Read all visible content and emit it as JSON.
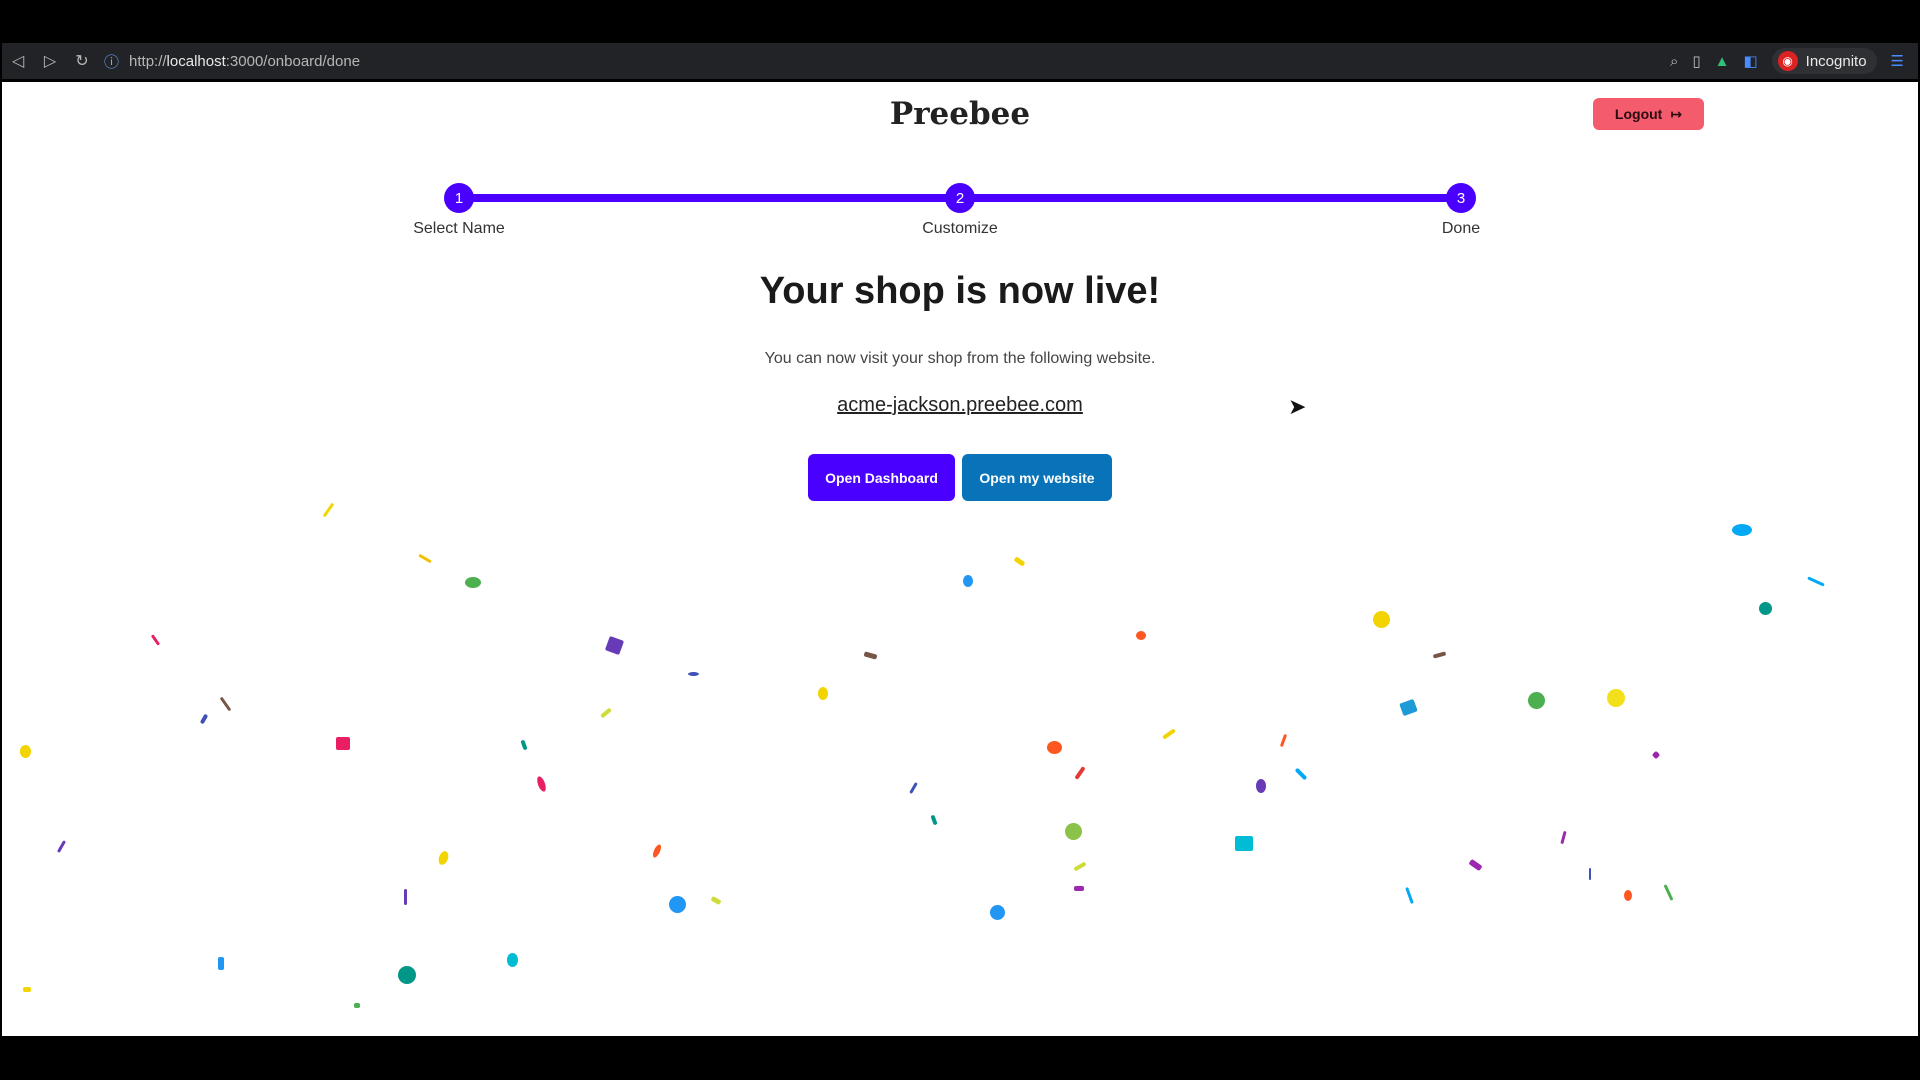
{
  "browser": {
    "url_prefix": "http://",
    "url_host": "localhost",
    "url_rest": ":3000/onboard/done",
    "incognito_label": "Incognito"
  },
  "header": {
    "brand": "Preebee",
    "logout_label": "Logout"
  },
  "stepper": {
    "steps": [
      {
        "number": "1",
        "label": "Select Name"
      },
      {
        "number": "2",
        "label": "Customize"
      },
      {
        "number": "3",
        "label": "Done"
      }
    ]
  },
  "main": {
    "headline": "Your shop is now live!",
    "subtext": "You can now visit your shop from the following website.",
    "shop_url": "acme-jackson.preebee.com",
    "open_dashboard_label": "Open Dashboard",
    "open_website_label": "Open my website"
  },
  "colors": {
    "primary": "#4a00ff",
    "website_button": "#0873b8",
    "logout": "#f45b6d"
  }
}
